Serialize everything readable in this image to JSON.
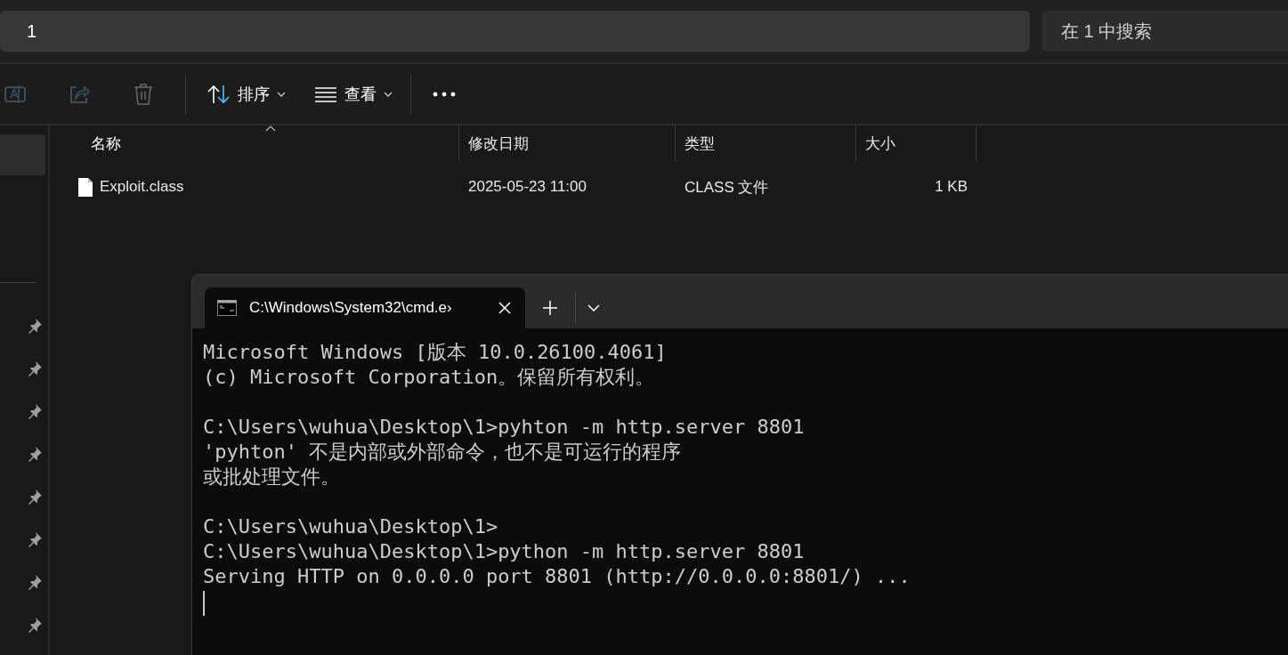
{
  "address_bar": {
    "value": "1"
  },
  "search": {
    "placeholder": "在 1 中搜索"
  },
  "toolbar": [
    {
      "kind": "rename",
      "disabled": true
    },
    {
      "kind": "share",
      "disabled": true
    },
    {
      "kind": "delete",
      "disabled": true
    },
    {
      "kind": "separator"
    },
    {
      "kind": "sort",
      "label": "排序",
      "disabled": false
    },
    {
      "kind": "view",
      "label": "查看",
      "disabled": false
    },
    {
      "kind": "separator"
    },
    {
      "kind": "more",
      "disabled": false
    }
  ],
  "sidebar": {
    "items": [
      {
        "kind": "nav",
        "selected": true
      },
      {
        "kind": "divider"
      },
      {
        "kind": "pinned",
        "selected": false
      },
      {
        "kind": "pinned",
        "selected": false
      },
      {
        "kind": "pinned",
        "selected": false
      },
      {
        "kind": "pinned",
        "selected": false
      },
      {
        "kind": "pinned",
        "selected": false
      },
      {
        "kind": "pinned",
        "selected": false
      },
      {
        "kind": "pinned",
        "selected": false
      },
      {
        "kind": "pinned",
        "selected": false
      }
    ]
  },
  "table": {
    "columns": [
      {
        "label": "名称",
        "sorted": true
      },
      {
        "label": "修改日期",
        "sorted": false
      },
      {
        "label": "类型",
        "sorted": false
      },
      {
        "label": "大小",
        "sorted": false
      }
    ],
    "rows": [
      {
        "name": "Exploit.class",
        "modified": "2025-05-23 11:00",
        "type": "CLASS 文件",
        "size": "1 KB"
      }
    ]
  },
  "terminal": {
    "tabs": [
      {
        "title": "C:\\Windows\\System32\\cmd.e›",
        "selected": true
      }
    ],
    "output": [
      [
        "Microsoft Windows [版本 10.0.26100.4061]",
        "(c) Microsoft Corporation。保留所有权利。"
      ],
      [
        "C:\\Users\\wuhua\\Desktop\\1>pyhton -m http.server 8801",
        "'pyhton' 不是内部或外部命令，也不是可运行的程序",
        "或批处理文件。"
      ],
      [
        "C:\\Users\\wuhua\\Desktop\\1>",
        "C:\\Users\\wuhua\\Desktop\\1>python -m http.server 8801",
        "Serving HTTP on 0.0.0.0 port 8801 (http://0.0.0.0:8801/) ..."
      ]
    ],
    "cursor_visible": true
  }
}
